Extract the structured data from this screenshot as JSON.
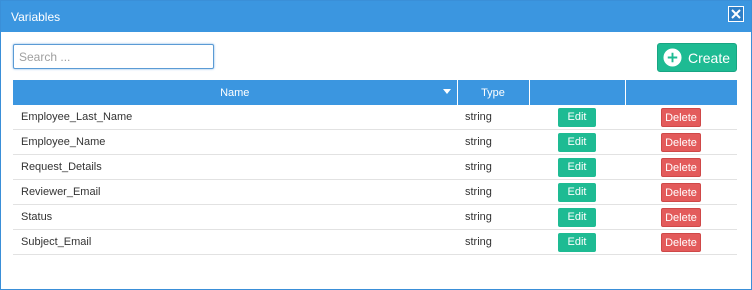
{
  "dialog": {
    "title": "Variables",
    "close_icon": "close-icon"
  },
  "search": {
    "placeholder": "Search ...",
    "value": ""
  },
  "create_button": {
    "label": "Create",
    "icon": "plus-circle-icon"
  },
  "table": {
    "headers": [
      "Name",
      "Type",
      "",
      ""
    ],
    "sorted_column": "Name",
    "rows": [
      {
        "name": "Employee_Last_Name",
        "type": "string",
        "edit": "Edit",
        "delete": "Delete"
      },
      {
        "name": "Employee_Name",
        "type": "string",
        "edit": "Edit",
        "delete": "Delete"
      },
      {
        "name": "Request_Details",
        "type": "string",
        "edit": "Edit",
        "delete": "Delete"
      },
      {
        "name": "Reviewer_Email",
        "type": "string",
        "edit": "Edit",
        "delete": "Delete"
      },
      {
        "name": "Status",
        "type": "string",
        "edit": "Edit",
        "delete": "Delete"
      },
      {
        "name": "Subject_Email",
        "type": "string",
        "edit": "Edit",
        "delete": "Delete"
      }
    ]
  },
  "colors": {
    "header_blue": "#3b96e0",
    "edit_green": "#1ebb93",
    "delete_red": "#e35b5b"
  }
}
